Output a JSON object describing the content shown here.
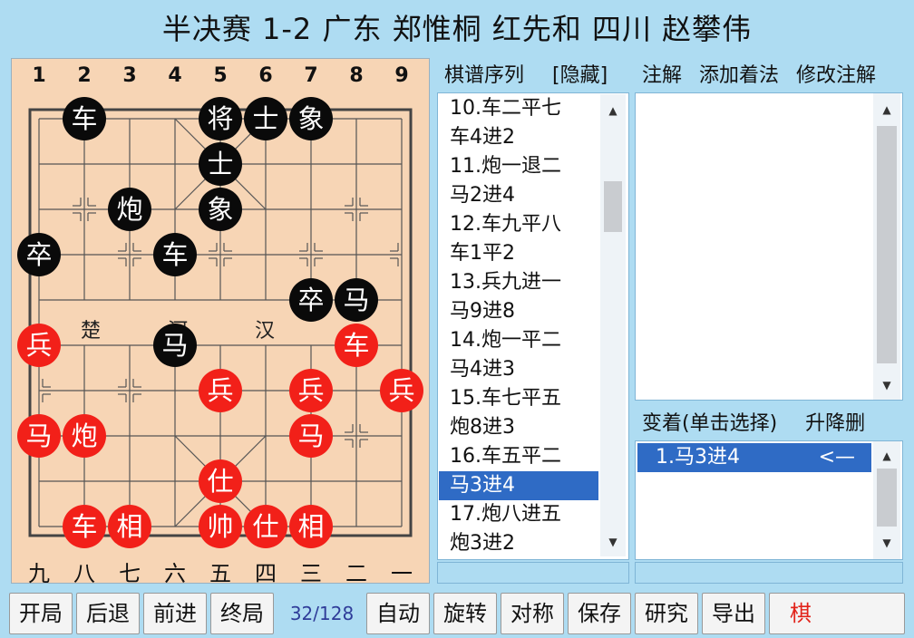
{
  "title": "半决赛 1-2 广东 郑惟桐 红先和 四川 赵攀伟",
  "board": {
    "file_numbers": [
      "1",
      "2",
      "3",
      "4",
      "5",
      "6",
      "7",
      "8",
      "9"
    ],
    "file_cn": [
      "九",
      "八",
      "七",
      "六",
      "五",
      "四",
      "三",
      "二",
      "一"
    ],
    "river_left": "楚",
    "river_mid": "河",
    "river_right": "汉",
    "colors": {
      "board": "#f7d5b5",
      "line": "#555555",
      "black_piece": "#0a0a0a",
      "red_piece": "#f22019"
    },
    "pieces": [
      {
        "label": "车",
        "side": "black",
        "file": 2,
        "rank": 1
      },
      {
        "label": "将",
        "side": "black",
        "file": 5,
        "rank": 1
      },
      {
        "label": "士",
        "side": "black",
        "file": 6,
        "rank": 1
      },
      {
        "label": "象",
        "side": "black",
        "file": 7,
        "rank": 1
      },
      {
        "label": "士",
        "side": "black",
        "file": 5,
        "rank": 2
      },
      {
        "label": "炮",
        "side": "black",
        "file": 3,
        "rank": 3
      },
      {
        "label": "象",
        "side": "black",
        "file": 5,
        "rank": 3
      },
      {
        "label": "卒",
        "side": "black",
        "file": 1,
        "rank": 4
      },
      {
        "label": "车",
        "side": "black",
        "file": 4,
        "rank": 4
      },
      {
        "label": "卒",
        "side": "black",
        "file": 7,
        "rank": 5
      },
      {
        "label": "马",
        "side": "black",
        "file": 8,
        "rank": 5
      },
      {
        "label": "马",
        "side": "black",
        "file": 4,
        "rank": 6
      },
      {
        "label": "兵",
        "side": "red",
        "file": 1,
        "rank": 6
      },
      {
        "label": "车",
        "side": "red",
        "file": 8,
        "rank": 6
      },
      {
        "label": "兵",
        "side": "red",
        "file": 5,
        "rank": 7
      },
      {
        "label": "兵",
        "side": "red",
        "file": 7,
        "rank": 7
      },
      {
        "label": "兵",
        "side": "red",
        "file": 9,
        "rank": 7
      },
      {
        "label": "马",
        "side": "red",
        "file": 1,
        "rank": 8
      },
      {
        "label": "炮",
        "side": "red",
        "file": 2,
        "rank": 8
      },
      {
        "label": "马",
        "side": "red",
        "file": 7,
        "rank": 8
      },
      {
        "label": "仕",
        "side": "red",
        "file": 5,
        "rank": 9
      },
      {
        "label": "车",
        "side": "red",
        "file": 2,
        "rank": 10
      },
      {
        "label": "相",
        "side": "red",
        "file": 3,
        "rank": 10
      },
      {
        "label": "帅",
        "side": "red",
        "file": 5,
        "rank": 10
      },
      {
        "label": "仕",
        "side": "red",
        "file": 6,
        "rank": 10
      },
      {
        "label": "相",
        "side": "red",
        "file": 7,
        "rank": 10
      }
    ]
  },
  "moves_panel": {
    "header": "棋谱序列",
    "hide_label": "[隐藏]",
    "lines": [
      "10.车二平七",
      "   车4进2",
      "11.炮一退二",
      "   马2进4",
      "12.车九平八",
      "   车1平2",
      "13.兵九进一",
      "   马9进8",
      "14.炮一平二",
      "   马4进3",
      "15.车七平五",
      "   炮8进3",
      "16.车五平二",
      "   马3进4",
      "17.炮八进五",
      "   炮3进2"
    ],
    "selected_index": 13
  },
  "notes_panel": {
    "tab_notes": "注解",
    "tab_add": "添加着法",
    "tab_edit": "修改注解"
  },
  "variations_panel": {
    "header": "变着(单击选择)",
    "actions": "升降删",
    "items": [
      {
        "label": "1.马3进4",
        "marker": "<—"
      }
    ]
  },
  "toolbar": {
    "start": "开局",
    "back": "后退",
    "forward": "前进",
    "end": "终局",
    "counter": "32/128",
    "auto": "自动",
    "rotate": "旋转",
    "mirror": "对称",
    "save": "保存",
    "research": "研究",
    "export": "导出",
    "last": "棋"
  }
}
